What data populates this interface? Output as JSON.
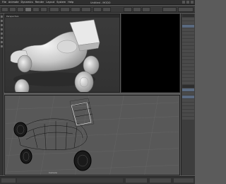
{
  "window": {
    "title": "Untitled - MODO"
  },
  "menu": [
    "File",
    "Animate",
    "Dynamics",
    "Render",
    "Layout",
    "System",
    "Help"
  ],
  "top_viewport": {
    "label": "Perspective"
  },
  "bottom_viewport": {
    "label": "Camera"
  },
  "right_panel": {
    "rows": 30
  },
  "colors": {
    "accent": "#5a6a80",
    "wire": "#000000"
  }
}
